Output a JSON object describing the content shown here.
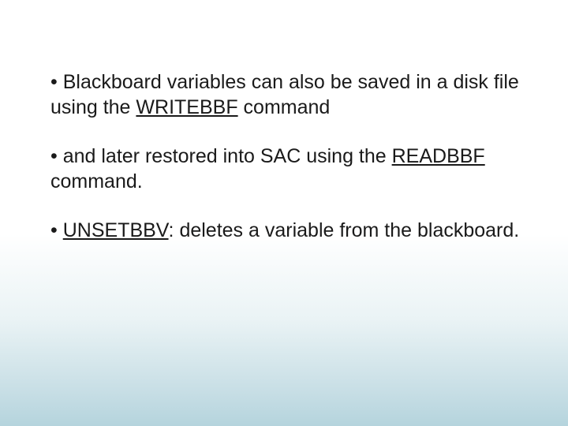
{
  "slide": {
    "bullets": [
      {
        "dot": "•",
        "p1": " Blackboard variables can also be saved in a disk file using the ",
        "cmd": "WRITEBBF",
        "p2": " command"
      },
      {
        "dot": "•",
        "p1": " and later restored into SAC using the ",
        "cmd": "READBBF",
        "p2": " command."
      },
      {
        "dot": "•",
        "p1": " ",
        "cmd": "UNSETBBV",
        "p2": ":  deletes a variable from the blackboard."
      }
    ]
  }
}
